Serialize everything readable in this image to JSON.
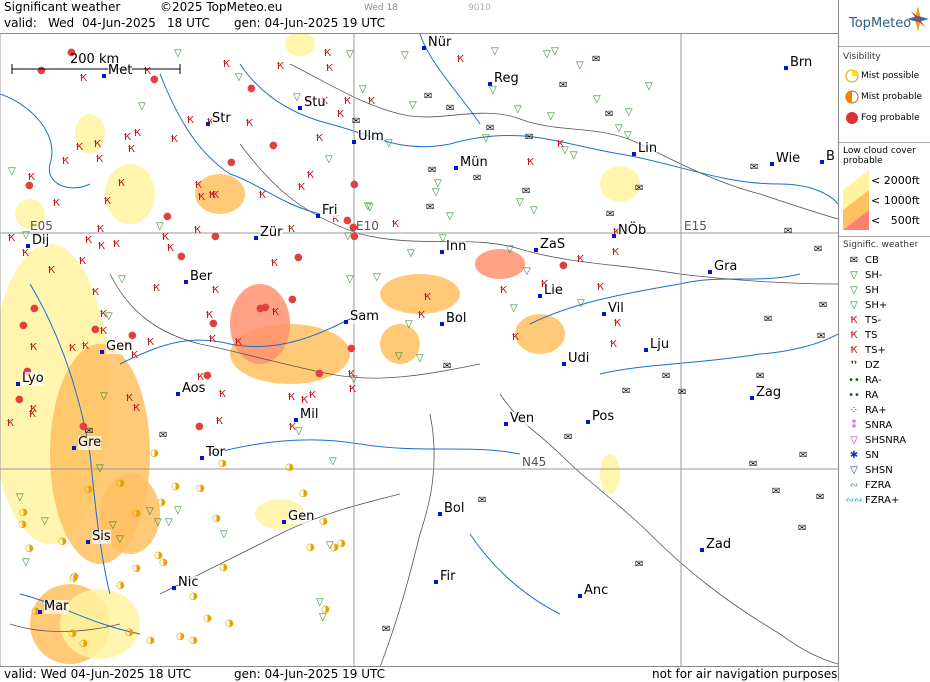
{
  "header": {
    "title": "Significant weather",
    "copyright": "©2025 TopMeteo.eu",
    "valid_prefix": "valid:",
    "valid_day": "Wed",
    "valid_date": "04-Jun-2025",
    "valid_time": "18 UTC",
    "gen": "gen: 04-Jun-2025 19 UTC",
    "tab_label": "Wed 18",
    "tab_code": "9010"
  },
  "footer": {
    "valid": "valid:  Wed  04-Jun-2025  18 UTC",
    "gen": "gen: 04-Jun-2025 19 UTC",
    "disclaimer": "not for air navigation purposes"
  },
  "scale": {
    "label": "200 km"
  },
  "grid_labels": [
    "E05",
    "E10",
    "E15",
    "N45"
  ],
  "cities": [
    "Nür",
    "Brn",
    "Met",
    "Reg",
    "Stu",
    "Str",
    "Ulm",
    "Lin",
    "Wie",
    "B",
    "Mün",
    "Fri",
    "Dij",
    "Zür",
    "Inn",
    "ZaS",
    "NÖb",
    "Gra",
    "Ber",
    "Lie",
    "Sam",
    "Bol",
    "Vil",
    "Gen",
    "Lju",
    "Udi",
    "Lyo",
    "Aos",
    "Zag",
    "Mil",
    "Ven",
    "Pos",
    "Gre",
    "Tor",
    "Bol",
    "Gen",
    "Zad",
    "Sis",
    "Nic",
    "Fir",
    "Anc",
    "Mar"
  ],
  "brand": {
    "name": "TopMeteo"
  },
  "legend": {
    "visibility": {
      "title": "Visibility",
      "items": [
        "Mist possible",
        "Mist probable",
        "Fog probable"
      ],
      "colors": [
        "#ffe000",
        "#ff8000",
        "#e03030"
      ]
    },
    "low_cloud": {
      "title_line1": "Low cloud cover",
      "title_line2": "probable",
      "items": [
        "< 2000ft",
        "< 1000ft",
        "<   500ft"
      ],
      "colors": [
        "#fff3a0",
        "#ffc060",
        "#ff8070"
      ]
    },
    "signif": {
      "title": "Signific. weather",
      "items": [
        "CB",
        "SH-",
        "SH",
        "SH+",
        "TS-",
        "TS",
        "TS+",
        "DZ",
        "RA-",
        "RA",
        "RA+",
        "SNRA",
        "SHSNRA",
        "SN",
        "SHSN",
        "FZRA",
        "FZRA+"
      ]
    }
  }
}
